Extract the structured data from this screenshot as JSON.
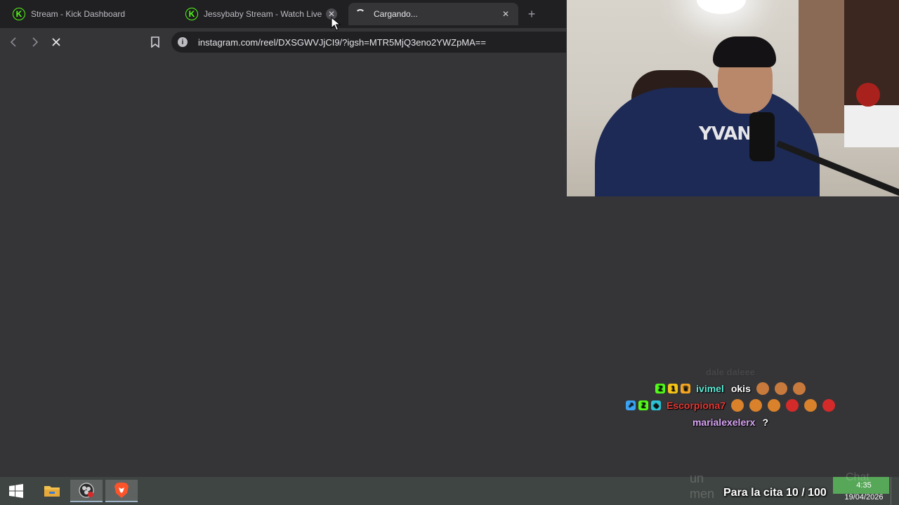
{
  "browser": {
    "tabs": [
      {
        "title": "Stream - Kick Dashboard",
        "favicon": "kick-icon"
      },
      {
        "title": "Jessybaby Stream - Watch Live o",
        "favicon": "kick-icon"
      },
      {
        "title": "Cargando...",
        "favicon": "loading-spinner",
        "active": true
      }
    ],
    "new_tab_glyph": "+",
    "close_glyph": "✕",
    "address": "instagram.com/reel/DXSGWVJjCI9/?igsh=MTR5MjQ3eno2YWZpMA==",
    "info_glyph": "i"
  },
  "webcam": {
    "shirt_text": "YVAN"
  },
  "chat": {
    "messages": [
      {
        "user": "",
        "text": "dale daleee",
        "user_color": "#e0443a",
        "faded": true
      },
      {
        "user": "ivimel",
        "text": "okis",
        "user_color": "#5eead4",
        "badges": [
          "Z",
          "1",
          "♛"
        ]
      },
      {
        "user": "Escorpiona7",
        "text": "",
        "user_color": "#e53935",
        "badges": [
          "↗",
          "Z",
          "◆"
        ]
      },
      {
        "user": "marialexelerx",
        "text": "?",
        "user_color": "#d9a5f5"
      }
    ]
  },
  "stream_overlay": {
    "goal_text": "Para la cita 10 / 100",
    "faded_chat_label": "Chat",
    "faded_input_text_1": "un",
    "faded_input_text_2": "men"
  },
  "taskbar": {
    "clock_time": "4:35",
    "clock_date": "19/04/2026"
  },
  "colors": {
    "kick_green": "#53fc18",
    "page_bg": "#353538",
    "tabstrip_bg": "#202023"
  }
}
